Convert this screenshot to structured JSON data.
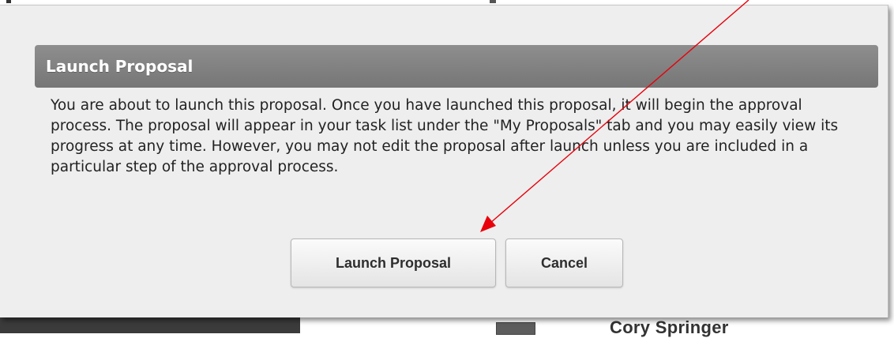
{
  "background": {
    "partial_name": "Cory Springer"
  },
  "dialog": {
    "title": "Launch Proposal",
    "message": "You are about to launch this proposal. Once you have launched this proposal, it will begin the approval process. The proposal will appear in your task list under the \"My Proposals\" tab and you may easily view its progress at any time. However, you may not edit the proposal after launch unless you are included in a particular step of the approval process.",
    "buttons": {
      "launch_label": "Launch Proposal",
      "cancel_label": "Cancel"
    }
  },
  "annotation": {
    "type": "arrow",
    "color": "#e8000b",
    "points_to": "launch-proposal-button"
  }
}
